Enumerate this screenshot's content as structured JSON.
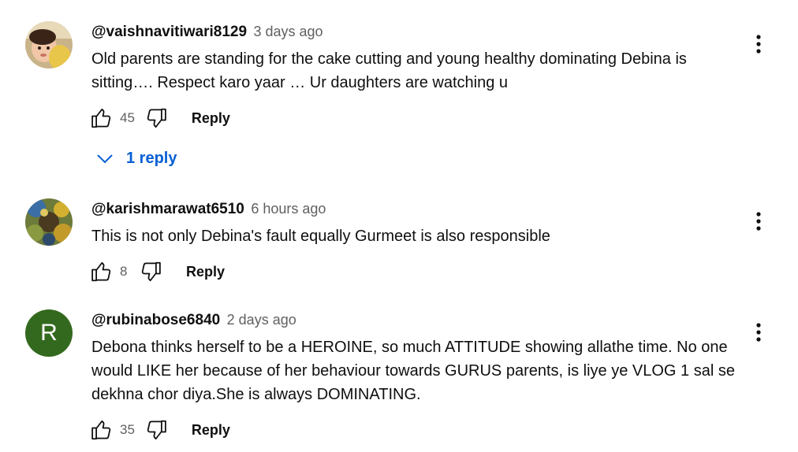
{
  "colors": {
    "text": "#0f0f0f",
    "secondary": "#606060",
    "link": "#065fd4",
    "avatar_r_bg": "#33691e"
  },
  "comments": [
    {
      "author": "@vaishnavitiwari8129",
      "time": "3 days ago",
      "text": "Old parents are standing for the cake cutting and young healthy dominating Debina is sitting…. Respect karo yaar … Ur daughters are watching u",
      "likes": "45",
      "reply_label": "Reply",
      "avatar_icon": "photo-avatar",
      "replies_label": "1 reply"
    },
    {
      "author": "@karishmarawat6510",
      "time": "6 hours ago",
      "text": "This is not only Debina's fault equally Gurmeet is also responsible",
      "likes": "8",
      "reply_label": "Reply",
      "avatar_icon": "photo-avatar"
    },
    {
      "author": "@rubinabose6840",
      "time": "2 days ago",
      "text": "Debona thinks herself to be a HEROINE, so much ATTITUDE showing allathe time. No one would LIKE her because of her behaviour towards GURUS parents, is liye ye VLOG 1 sal se dekhna chor diya.She is always DOMINATING.",
      "likes": "35",
      "reply_label": "Reply",
      "avatar_letter": "R"
    }
  ]
}
